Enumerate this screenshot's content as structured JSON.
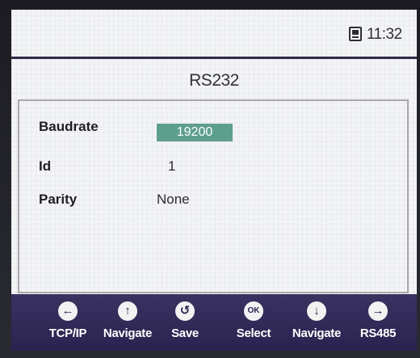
{
  "status": {
    "clock": "11:32",
    "storage_icon": "sd-card-icon"
  },
  "page": {
    "title": "RS232"
  },
  "fields": [
    {
      "label": "Baudrate",
      "value": "19200",
      "selected": true
    },
    {
      "label": "Id",
      "value": "1"
    },
    {
      "label": "Parity",
      "value": "None"
    }
  ],
  "footer": {
    "buttons": [
      {
        "label": "TCP/IP",
        "icon": "arrow-left-icon",
        "glyph": "←"
      },
      {
        "label": "Navigate",
        "icon": "arrow-up-icon",
        "glyph": "↑"
      },
      {
        "label": "Save",
        "icon": "undo-icon",
        "glyph": "↺"
      },
      {
        "label": "Select",
        "icon": "ok-icon",
        "glyph": "OK"
      },
      {
        "label": "Navigate",
        "icon": "arrow-down-icon",
        "glyph": "↓"
      },
      {
        "label": "RS485",
        "icon": "arrow-right-icon",
        "glyph": "→"
      }
    ]
  },
  "colors": {
    "accent": "#5e9e8c",
    "footer": "#2e2756",
    "bezel": "#1c1c22"
  }
}
